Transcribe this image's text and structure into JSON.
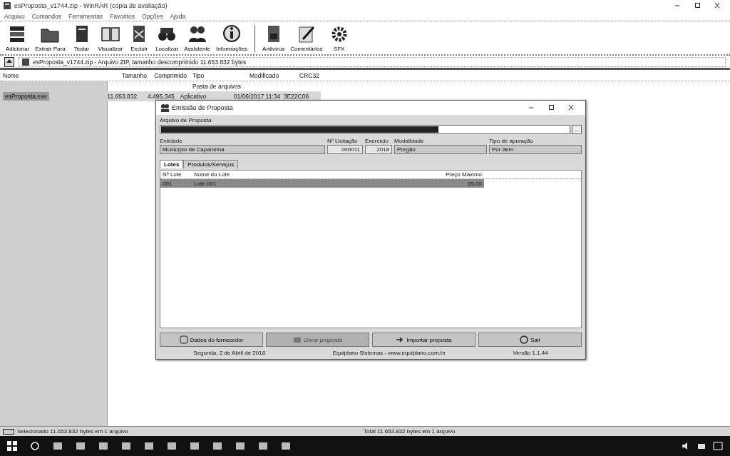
{
  "window": {
    "title": "esProposta_v1744.zip - WinRAR (cópia de avaliação)"
  },
  "menu": [
    "Arquivo",
    "Comandos",
    "Ferramentas",
    "Favoritos",
    "Opções",
    "Ajuda"
  ],
  "toolbar": [
    {
      "label": "Adicionar"
    },
    {
      "label": "Extrair Para"
    },
    {
      "label": "Testar"
    },
    {
      "label": "Visualizar"
    },
    {
      "label": "Excluir"
    },
    {
      "label": "Localizar"
    },
    {
      "label": "Assistente"
    },
    {
      "label": "Informações"
    },
    {
      "label": "Antivírus"
    },
    {
      "label": "Comentários"
    },
    {
      "label": "SFX"
    }
  ],
  "path": "esProposta_v1744.zip - Arquivo ZIP, tamanho descomprimido 11.653.832 bytes",
  "table": {
    "columns": [
      "Nome",
      "Tamanho",
      "Comprimido",
      "Tipo",
      "Modificado",
      "CRC32"
    ],
    "rows": [
      {
        "type": "Pasta de arquivos",
        "selected": false
      },
      {
        "name": "esProposta.exe",
        "size": "11.653.832",
        "packed": "4.495.345",
        "type": "Aplicativo",
        "modified": "01/06/2017 11:34",
        "crc": "3E22C06",
        "selected": true
      }
    ]
  },
  "dialog": {
    "title": "Emissão de Proposta",
    "file_label": "Arquivo de Proposta",
    "browse_label": "...",
    "fields": [
      {
        "label": "Entidade",
        "value": "Município de Capanema"
      },
      {
        "label": "Nº Licitação",
        "value": "000011"
      },
      {
        "label": "Exercício",
        "value": "2018"
      },
      {
        "label": "Modalidade",
        "value": "Pregão"
      },
      {
        "label": "Tipo de apuração",
        "value": "Por Item"
      }
    ],
    "tabs": [
      {
        "label": "Lotes",
        "selected": true
      },
      {
        "label": "Produtos/Serviços",
        "selected": false
      }
    ],
    "columns": [
      "Nº Lote",
      "Nome do Lote",
      "Preço Máximo"
    ],
    "rows": [
      {
        "cells": [
          "001",
          "Lote 001",
          "65,00"
        ],
        "selected": true
      }
    ],
    "buttons": [
      {
        "label": "Dados do fornecedor",
        "disabled": false
      },
      {
        "label": "Gerar proposta",
        "disabled": true
      },
      {
        "label": "Importar proposta",
        "disabled": false
      },
      {
        "label": "Sair",
        "disabled": false
      }
    ],
    "footer": [
      "Segunda, 2 de Abril de 2018",
      "Equiplano Sistemas - www.equiplano.com.br",
      "Versão 1.1.44"
    ]
  },
  "status_bar": [
    "Selecionado 11.653.832 bytes em 1 arquivo",
    "Total 11.653.832 bytes em 1 arquivo"
  ]
}
